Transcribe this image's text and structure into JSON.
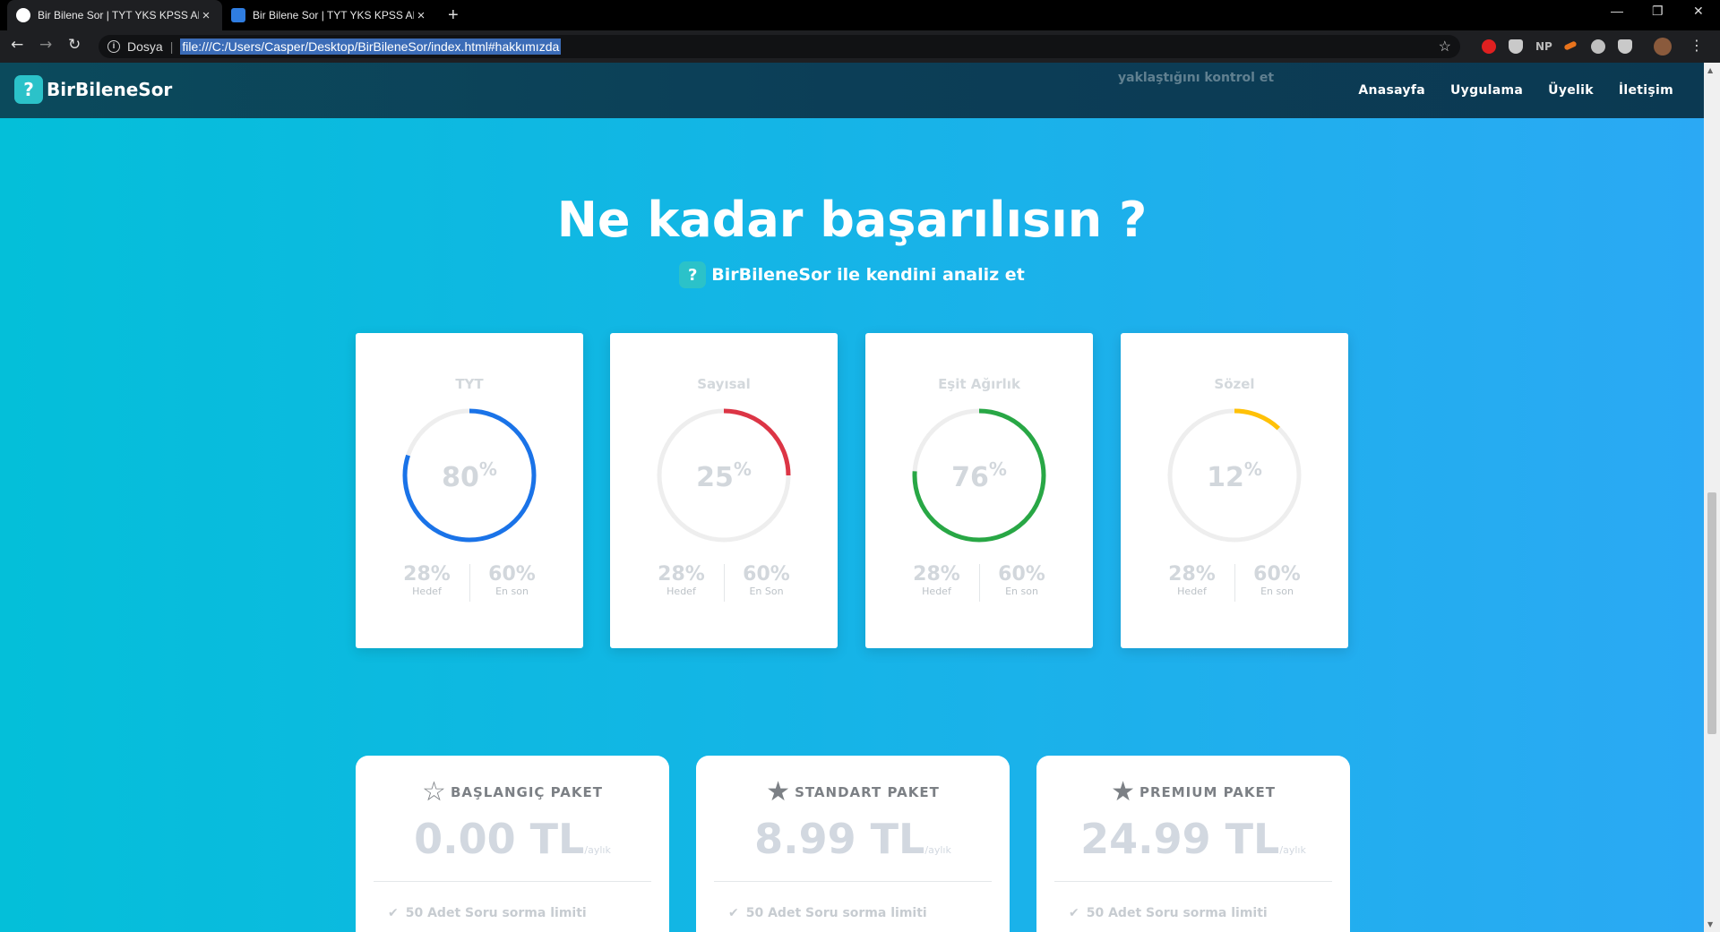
{
  "browser": {
    "tabs": [
      {
        "title": "Bir Bilene Sor | TYT YKS KPSS ALE",
        "active": true
      },
      {
        "title": "Bir Bilene Sor | TYT YKS KPSS ALE",
        "active": false
      }
    ],
    "new_tab": "+",
    "window": {
      "minimize": "—",
      "restore": "❐",
      "close": "✕"
    },
    "nav": {
      "back": "←",
      "forward": "→",
      "reload": "↻"
    },
    "security_label": "Dosya",
    "url": "file:///C:/Users/Casper/Desktop/BirBileneSor/index.html#hakkımızda",
    "bookmark_icon": "star-icon",
    "extensions": [
      "opera-icon",
      "shield-icon",
      "np-icon",
      "arrow-icon",
      "discord-icon",
      "shield-icon",
      "avatar",
      "menu-icon"
    ],
    "np_label": "NP",
    "menu_label": "⋮"
  },
  "site": {
    "brand": "BirBileneSor",
    "brand_icon": "?",
    "ghost_text": "yaklaştığını kontrol et",
    "menu": [
      "Anasayfa",
      "Uygulama",
      "Üyelik",
      "İletişim"
    ]
  },
  "hero": {
    "title": "Ne kadar başarılısın ?",
    "subtitle": "BirBileneSor ile kendini analiz et"
  },
  "cards": [
    {
      "title": "TYT",
      "percent": 80,
      "percent_label": "80",
      "color": "#1a73e8",
      "target": "28%",
      "target_label": "Hedef",
      "last": "60%",
      "last_label": "En son"
    },
    {
      "title": "Sayısal",
      "percent": 25,
      "percent_label": "25",
      "color": "#dc3545",
      "target": "28%",
      "target_label": "Hedef",
      "last": "60%",
      "last_label": "En Son"
    },
    {
      "title": "Eşit Ağırlık",
      "percent": 76,
      "percent_label": "76",
      "color": "#28a745",
      "target": "28%",
      "target_label": "Hedef",
      "last": "60%",
      "last_label": "En son"
    },
    {
      "title": "Sözel",
      "percent": 12,
      "percent_label": "12",
      "color": "#ffc107",
      "target": "28%",
      "target_label": "Hedef",
      "last": "60%",
      "last_label": "En son"
    }
  ],
  "percent_sign": "%",
  "packages": [
    {
      "name": "BAŞLANGIÇ PAKET",
      "star": "☆",
      "price": "0.00 TL",
      "period": "/aylık",
      "feature": "50 Adet Soru sorma limiti"
    },
    {
      "name": "STANDART PAKET",
      "star": "★",
      "price": "8.99 TL",
      "period": "/aylık",
      "feature": "50 Adet Soru sorma limiti"
    },
    {
      "name": "PREMIUM PAKET",
      "star": "★",
      "price": "24.99 TL",
      "period": "/aylık",
      "feature": "50 Adet Soru sorma limiti"
    }
  ],
  "check": "✔"
}
